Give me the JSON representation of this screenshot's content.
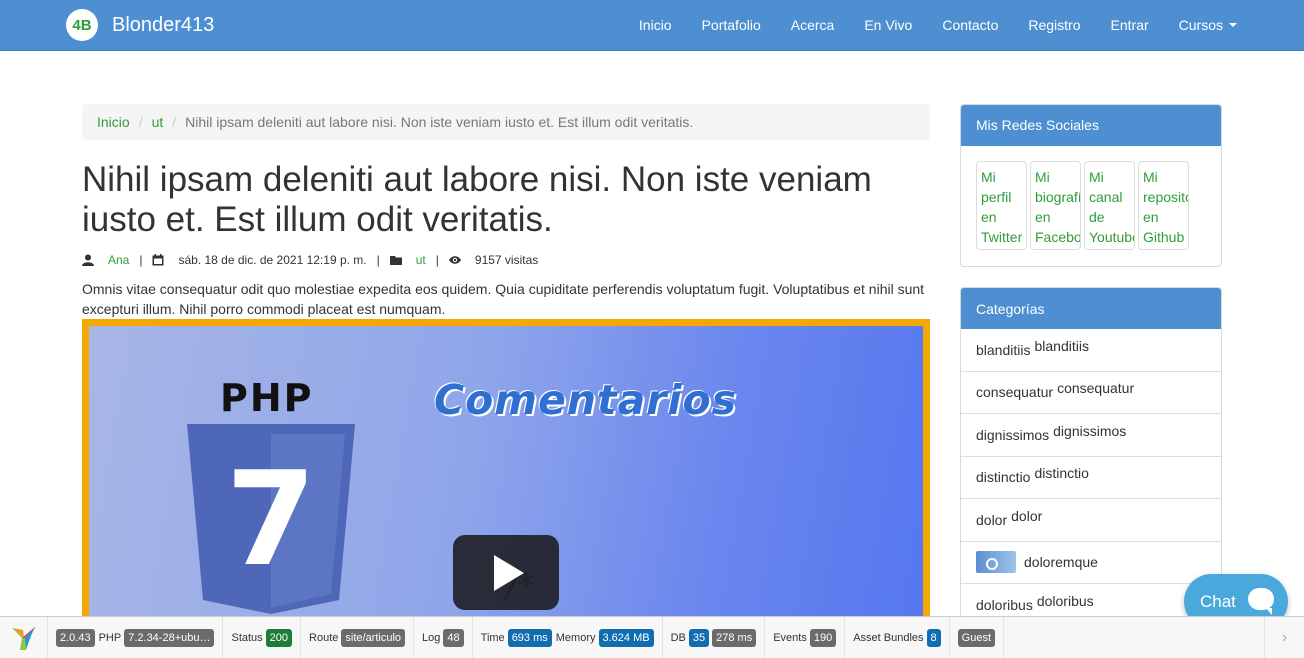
{
  "navbar": {
    "brand_logo_text": "4B",
    "brand_name": "Blonder413",
    "items": [
      {
        "label": "Inicio"
      },
      {
        "label": "Portafolio"
      },
      {
        "label": "Acerca"
      },
      {
        "label": "En Vivo"
      },
      {
        "label": "Contacto"
      },
      {
        "label": "Registro"
      },
      {
        "label": "Entrar"
      },
      {
        "label": "Cursos"
      }
    ],
    "color": "#4e8fd1"
  },
  "breadcrumb": {
    "home": "Inicio",
    "category": "ut",
    "current": "Nihil ipsam deleniti aut labore nisi. Non iste veniam iusto et. Est illum odit veritatis."
  },
  "article": {
    "title": "Nihil ipsam deleniti aut labore nisi. Non iste veniam iusto et. Est illum odit veritatis.",
    "meta": {
      "author": "Ana",
      "date": "sáb. 18 de dic. de 2021 12:19 p. m.",
      "category": "ut",
      "visits": "9157 visitas",
      "separator": "|"
    },
    "lead": "Omnis vitae consequatur odit quo molestiae expedita eos quidem. Quia cupiditate perferendis voluptatum fugit. Voluptatibus et nihil sunt excepturi illum. Nihil porro commodi placeat est numquam.",
    "video": {
      "php_text": "PHP",
      "heading": "Comentarios",
      "shield_number": "7",
      "comment_glyph": "/*"
    }
  },
  "sidebar": {
    "social": {
      "heading": "Mis Redes Sociales",
      "links": [
        {
          "line1": "Mi",
          "line2": "perfil",
          "line3": "en",
          "line4": "Twitter"
        },
        {
          "line1": "Mi",
          "line2": "biografía",
          "line3": "en",
          "line4": "Facebook"
        },
        {
          "line1": "Mi",
          "line2": "canal",
          "line3": "de",
          "line4": "Youtube"
        },
        {
          "line1": "Mi",
          "line2": "repositorio",
          "line3": "en",
          "line4": "Github"
        }
      ]
    },
    "categories": {
      "heading": "Categorías",
      "items": [
        {
          "a": "blanditiis",
          "b": "blanditiis"
        },
        {
          "a": "consequatur",
          "b": "consequatur"
        },
        {
          "a": "dignissimos",
          "b": "dignissimos"
        },
        {
          "a": "distinctio",
          "b": "distinctio"
        },
        {
          "a": "dolor",
          "b": "dolor"
        },
        {
          "a": "",
          "b": "doloremque"
        },
        {
          "a": "doloribus",
          "b": "doloribus"
        }
      ]
    }
  },
  "chat": {
    "label": "Chat"
  },
  "debug_toolbar": {
    "version": "2.0.43",
    "php_label": "PHP",
    "php_version": "7.2.34-28+ubu…",
    "status_label": "Status",
    "status_value": "200",
    "route_label": "Route",
    "route_value": "site/articulo",
    "log_label": "Log",
    "log_value": "48",
    "time_label": "Time",
    "time_value": "693 ms",
    "memory_label": "Memory",
    "memory_value": "3.624 MB",
    "db_label": "DB",
    "db_queries": "35",
    "db_time": "278 ms",
    "events_label": "Events",
    "events_value": "190",
    "bundles_label": "Asset Bundles",
    "bundles_value": "8",
    "user_value": "Guest",
    "arrow": "›"
  }
}
